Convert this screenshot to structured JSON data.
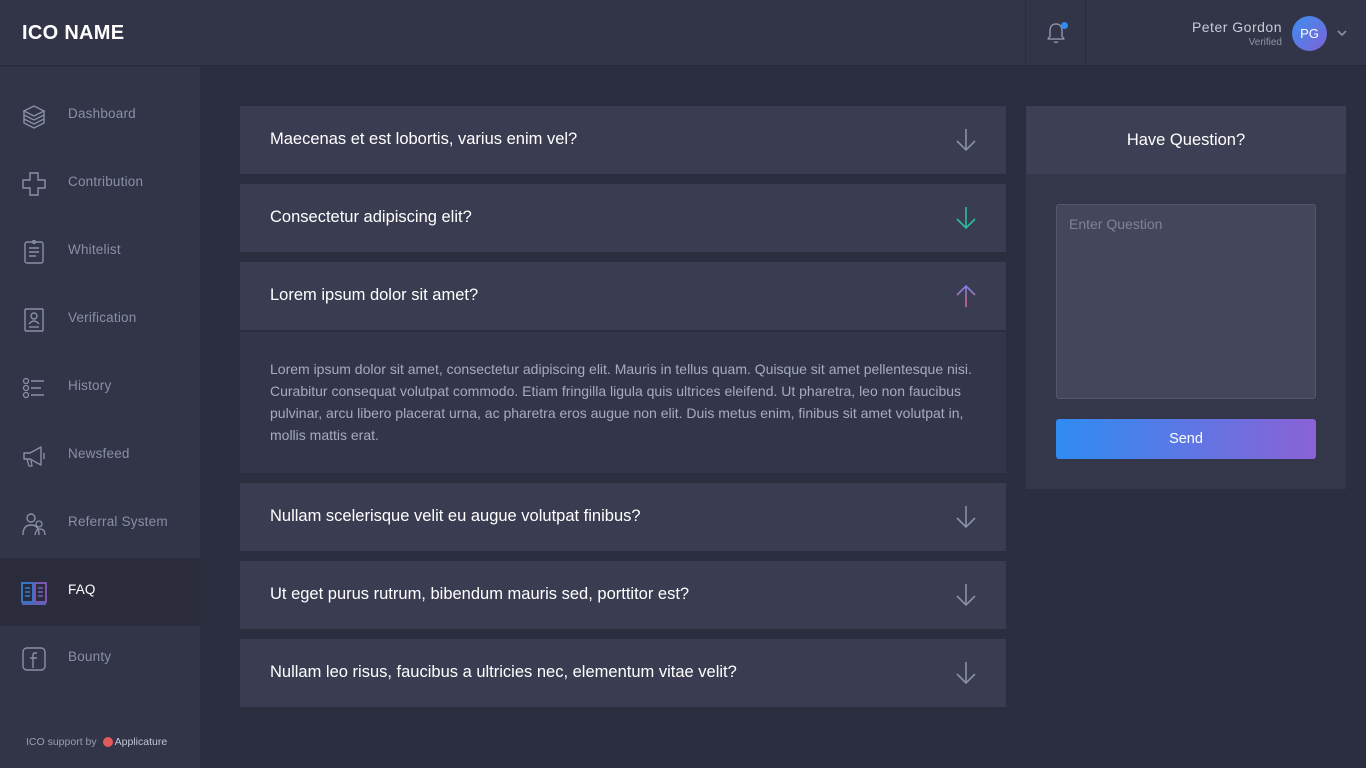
{
  "header": {
    "logo": "ICO NAME",
    "notification_icon": "bell-icon",
    "user": {
      "name": "Peter  Gordon",
      "status": "Verified",
      "initials": "PG"
    },
    "user_menu_icon": "chevron-down-icon"
  },
  "sidebar": {
    "items": [
      {
        "label": "Dashboard",
        "icon": "dashboard-stack-icon",
        "active": false
      },
      {
        "label": "Contribution",
        "icon": "contribution-plus-icon",
        "active": false
      },
      {
        "label": "Whitelist",
        "icon": "whitelist-list-icon",
        "active": false
      },
      {
        "label": "Verification",
        "icon": "verification-id-icon",
        "active": false
      },
      {
        "label": "History",
        "icon": "history-list-icon",
        "active": false
      },
      {
        "label": "Newsfeed",
        "icon": "megaphone-icon",
        "active": false
      },
      {
        "label": "Referral System",
        "icon": "users-icon",
        "active": false
      },
      {
        "label": "FAQ",
        "icon": "book-icon",
        "active": true
      },
      {
        "label": "Bounty",
        "icon": "facebook-icon",
        "active": false
      }
    ],
    "support_text": "ICO support by",
    "support_brand": "Applicature"
  },
  "faq": {
    "items": [
      {
        "question": "Maecenas et est lobortis, varius enim vel?",
        "expanded": false
      },
      {
        "question": "Consectetur adipiscing elit?",
        "expanded": false
      },
      {
        "question": "Lorem ipsum dolor sit amet?",
        "expanded": true
      },
      {
        "question": "Nullam scelerisque velit eu augue volutpat finibus?",
        "expanded": false
      },
      {
        "question": "Ut eget purus rutrum, bibendum mauris sed, porttitor est?",
        "expanded": false
      },
      {
        "question": "Nullam leo risus, faucibus a ultricies nec, elementum vitae velit?",
        "expanded": false
      }
    ],
    "answer": "Lorem ipsum dolor sit amet, consectetur adipiscing elit. Mauris in tellus quam. Quisque sit amet pellentesque nisi. Curabitur consequat volutpat commodo. Etiam fringilla ligula quis ultrices eleifend. Ut pharetra, leo non faucibus pulvinar, arcu libero placerat urna, ac pharetra eros augue non elit. Duis metus enim, finibus sit amet volutpat in, mollis mattis erat."
  },
  "question_panel": {
    "title": "Have Question?",
    "placeholder": "Enter Question",
    "value": "",
    "send_label": "Send"
  },
  "colors": {
    "accent_blue": "#2f8cf2",
    "accent_purple": "#8a62d6",
    "arrow_default": "#8a8fa8",
    "arrow_hover": "#2bbd9c",
    "arrow_active": "#e0647a"
  }
}
